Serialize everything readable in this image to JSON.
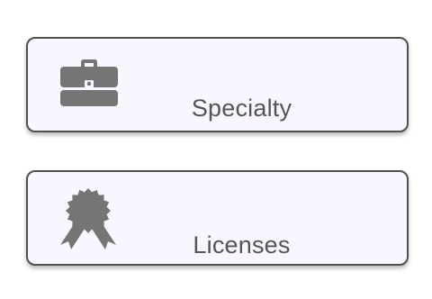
{
  "cards": [
    {
      "label": "Specialty",
      "icon": "briefcase-icon"
    },
    {
      "label": "Licenses",
      "icon": "award-badge-icon"
    }
  ],
  "colors": {
    "card_background": "#f7f8ff",
    "card_border": "#505050",
    "icon": "#757575",
    "text": "#555555"
  }
}
